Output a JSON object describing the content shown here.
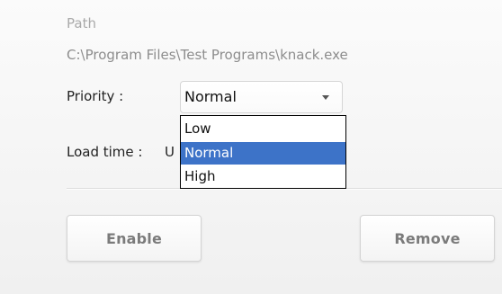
{
  "form": {
    "path_label": "Path",
    "path_value": "C:\\Program Files\\Test Programs\\knack.exe",
    "priority_label": "Priority :",
    "priority_selected": "Normal",
    "load_time_label": "Load time :",
    "load_time_value": "U"
  },
  "dropdown": {
    "options": [
      {
        "label": "Low"
      },
      {
        "label": "Normal"
      },
      {
        "label": "High"
      }
    ],
    "selected_index": 1
  },
  "actions": {
    "enable_label": "Enable",
    "remove_label": "Remove"
  },
  "colors": {
    "selection": "#3d73c8"
  }
}
